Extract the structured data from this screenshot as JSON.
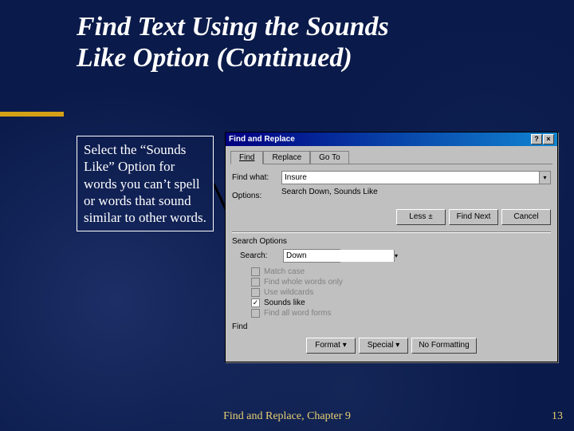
{
  "slide": {
    "title_line1": "Find Text Using the Sounds",
    "title_line2": "Like Option (Continued)",
    "callout": "Select the “Sounds Like” Option for words you can’t spell or words that sound similar to other words.",
    "footer": "Find and Replace, Chapter 9",
    "page_number": "13"
  },
  "dialog": {
    "title": "Find and Replace",
    "help_btn": "?",
    "close_btn": "×",
    "tabs": {
      "find": "Find",
      "replace": "Replace",
      "goto": "Go To"
    },
    "find_what_label": "Find what:",
    "find_what_value": "Insure",
    "options_label": "Options:",
    "options_value": "Search Down, Sounds Like",
    "buttons": {
      "less": "Less ±",
      "find_next": "Find Next",
      "cancel": "Cancel"
    },
    "search_options_label": "Search Options",
    "search_label": "Search:",
    "search_value": "Down",
    "checkboxes": {
      "match_case": "Match case",
      "whole_words": "Find whole words only",
      "wildcards": "Use wildcards",
      "sounds_like": "Sounds like",
      "all_forms": "Find all word forms"
    },
    "find_group_label": "Find",
    "bottom": {
      "format": "Format ▾",
      "special": "Special ▾",
      "no_formatting": "No Formatting"
    }
  }
}
